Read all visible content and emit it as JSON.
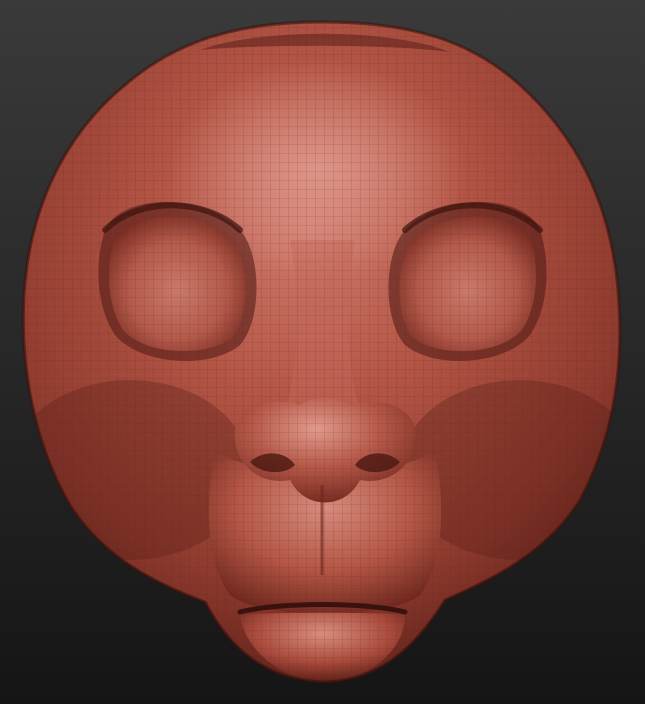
{
  "viewport": {
    "background_top": "#3a3a3a",
    "background_bottom": "#151515"
  },
  "material": {
    "base": "#a8473a",
    "light": "#d8897c",
    "mid": "#b65545",
    "shadow": "#5a1f17",
    "deep_shadow": "#3a120d",
    "wire": "#6e2a22"
  },
  "subject": "sculpt-head-mesh"
}
